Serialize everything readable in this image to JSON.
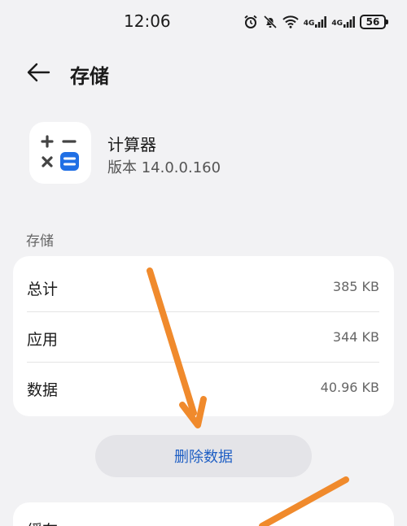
{
  "status_bar": {
    "time": "12:06",
    "network_1": "4G",
    "network_2": "4G",
    "battery": "56"
  },
  "header": {
    "title": "存储"
  },
  "app": {
    "name": "计算器",
    "version": "版本 14.0.0.160",
    "icon_accent": "#1f6fe5"
  },
  "storage": {
    "section_label": "存储",
    "rows": [
      {
        "label": "总计",
        "value": "385 KB"
      },
      {
        "label": "应用",
        "value": "344 KB"
      },
      {
        "label": "数据",
        "value": "40.96 KB"
      }
    ]
  },
  "actions": {
    "delete_data_label": "删除数据"
  },
  "cache": {
    "label": "缓存"
  },
  "colors": {
    "background": "#f2f2f4",
    "accent_link": "#1f5fc4",
    "annotation_arrow": "#f08a2c"
  }
}
